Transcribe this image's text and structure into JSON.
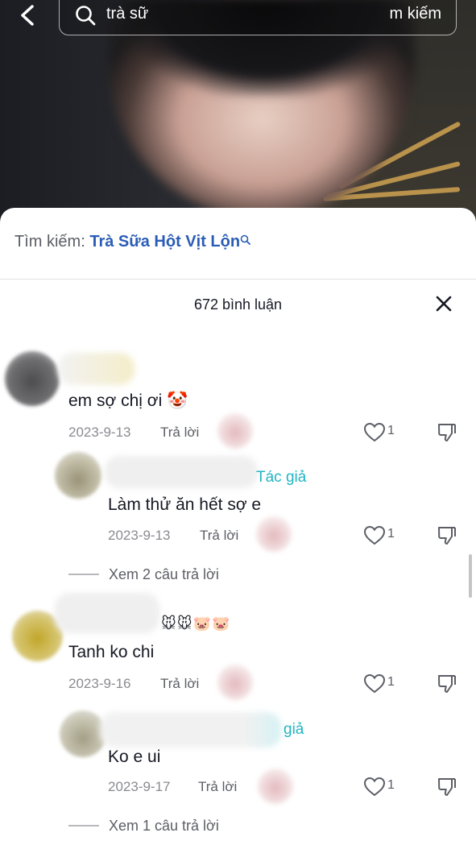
{
  "header": {
    "search_query": "trà sữ",
    "search_action": "m kiếm"
  },
  "related_search": {
    "label": "Tìm kiếm:",
    "keyword": "Trà Sữa Hột Vịt Lộn"
  },
  "comments_header": {
    "count_label": "672 bình luận"
  },
  "comments": [
    {
      "text": "em sợ chị ơi 🤡",
      "date": "2023-9-13",
      "reply_label": "Trả lời",
      "likes": "1",
      "replies": [
        {
          "author_tag": "Tác giả",
          "text": "Làm thử ăn hết sợ e",
          "date": "2023-9-13",
          "reply_label": "Trả lời",
          "likes": "1"
        }
      ],
      "view_more": "Xem 2 câu trả lời"
    },
    {
      "name_emojis": "🐭🐭🐷🐷",
      "text": "Tanh ko chi",
      "date": "2023-9-16",
      "reply_label": "Trả lời",
      "likes": "1",
      "replies": [
        {
          "author_tag": "giả",
          "text": "Ko e ui",
          "date": "2023-9-17",
          "reply_label": "Trả lời",
          "likes": "1"
        }
      ],
      "view_more": "Xem 1 câu trả lời"
    }
  ],
  "colors": {
    "link_blue": "#2b5db7",
    "author_cyan": "#20b5c3",
    "muted_gray": "#8a8b91"
  },
  "icons": [
    "back-arrow-icon",
    "search-icon",
    "close-icon",
    "heart-icon",
    "dislike-icon",
    "small-search-icon"
  ]
}
